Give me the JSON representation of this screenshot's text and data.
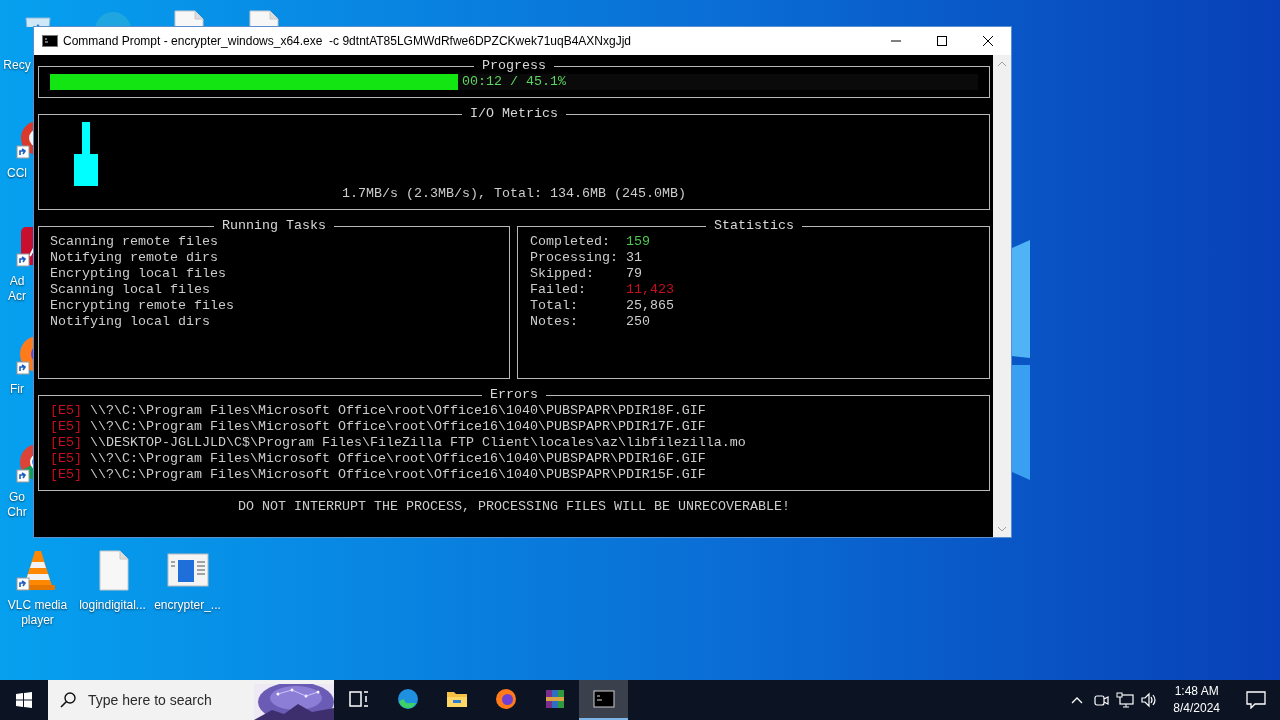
{
  "desktop": {
    "icons": [
      {
        "kind": "recycle-bin",
        "lines": [
          "Recy"
        ]
      },
      {
        "kind": "edge"
      },
      {
        "kind": "file"
      },
      {
        "kind": "file"
      },
      {
        "kind": "ccleaner",
        "shortcut": true,
        "lines": [
          "CCl"
        ]
      },
      {
        "kind": "acrobat",
        "shortcut": true,
        "lines": [
          "Ad",
          "Acr"
        ]
      },
      {
        "kind": "firefox",
        "shortcut": true,
        "lines": [
          "Fir"
        ]
      },
      {
        "kind": "chrome",
        "shortcut": true,
        "lines": [
          "Go",
          "Chr"
        ]
      },
      {
        "kind": "vlc",
        "shortcut": true,
        "lines": [
          "VLC media",
          "player"
        ]
      },
      {
        "kind": "file",
        "shortcut": false,
        "lines": [
          "logindigital..."
        ]
      },
      {
        "kind": "app-window",
        "shortcut": false,
        "lines": [
          "encrypter_..."
        ]
      }
    ]
  },
  "window": {
    "title": "Command Prompt - encrypter_windows_x64.exe  -c 9dtntAT85LGMWdRfwe6DPZCKwek71uqB4AXNxgJjd"
  },
  "progress": {
    "title": "Progress",
    "level": 0.44,
    "reading": "00:12 / 45.1%"
  },
  "io_metrics": {
    "title": "I/O Metrics",
    "summary": "1.7MB/s (2.3MB/s), Total: 134.6MB (245.0MB)"
  },
  "running_tasks": {
    "title": "Running Tasks",
    "items": [
      "Scanning remote files",
      "Notifying remote dirs",
      "Encrypting local files",
      "Scanning local files",
      "Encrypting remote files",
      "Notifying local dirs"
    ]
  },
  "statistics": {
    "title": "Statistics",
    "items": [
      {
        "label": "Completed:",
        "value": "159",
        "color": "#4ec94e"
      },
      {
        "label": "Processing:",
        "value": "31",
        "color": "#cccccc"
      },
      {
        "label": "Skipped:",
        "value": "79",
        "color": "#cccccc"
      },
      {
        "label": "Failed:",
        "value": "11,423",
        "color": "#c50f1f"
      },
      {
        "label": "Total:",
        "value": "25,865",
        "color": "#cccccc"
      },
      {
        "label": "Notes:",
        "value": "250",
        "color": "#cccccc"
      }
    ]
  },
  "errors": {
    "title": "Errors",
    "items": [
      {
        "code": "[E5]",
        "path": "\\\\?\\C:\\Program Files\\Microsoft Office\\root\\Office16\\1040\\PUBSPAPR\\PDIR18F.GIF"
      },
      {
        "code": "[E5]",
        "path": "\\\\?\\C:\\Program Files\\Microsoft Office\\root\\Office16\\1040\\PUBSPAPR\\PDIR17F.GIF"
      },
      {
        "code": "[E5]",
        "path": "\\\\DESKTOP-JGLLJLD\\C$\\Program Files\\FileZilla FTP Client\\locales\\az\\libfilezilla.mo"
      },
      {
        "code": "[E5]",
        "path": "\\\\?\\C:\\Program Files\\Microsoft Office\\root\\Office16\\1040\\PUBSPAPR\\PDIR16F.GIF"
      },
      {
        "code": "[E5]",
        "path": "\\\\?\\C:\\Program Files\\Microsoft Office\\root\\Office16\\1040\\PUBSPAPR\\PDIR15F.GIF"
      }
    ]
  },
  "footer": "DO NOT INTERRUPT THE PROCESS, PROCESSING FILES WILL BE UNRECOVERABLE!",
  "taskbar": {
    "search": {
      "placeholder": "Type here to search"
    },
    "apps": [
      {
        "kind": "task-view",
        "selected": false
      },
      {
        "kind": "edge",
        "selected": false
      },
      {
        "kind": "explorer",
        "selected": false
      },
      {
        "kind": "firefox",
        "selected": false
      },
      {
        "kind": "winrar",
        "selected": false
      },
      {
        "kind": "terminal",
        "selected": true
      }
    ],
    "clock": {
      "time": "1:48 AM",
      "date": "8/4/2024"
    }
  }
}
